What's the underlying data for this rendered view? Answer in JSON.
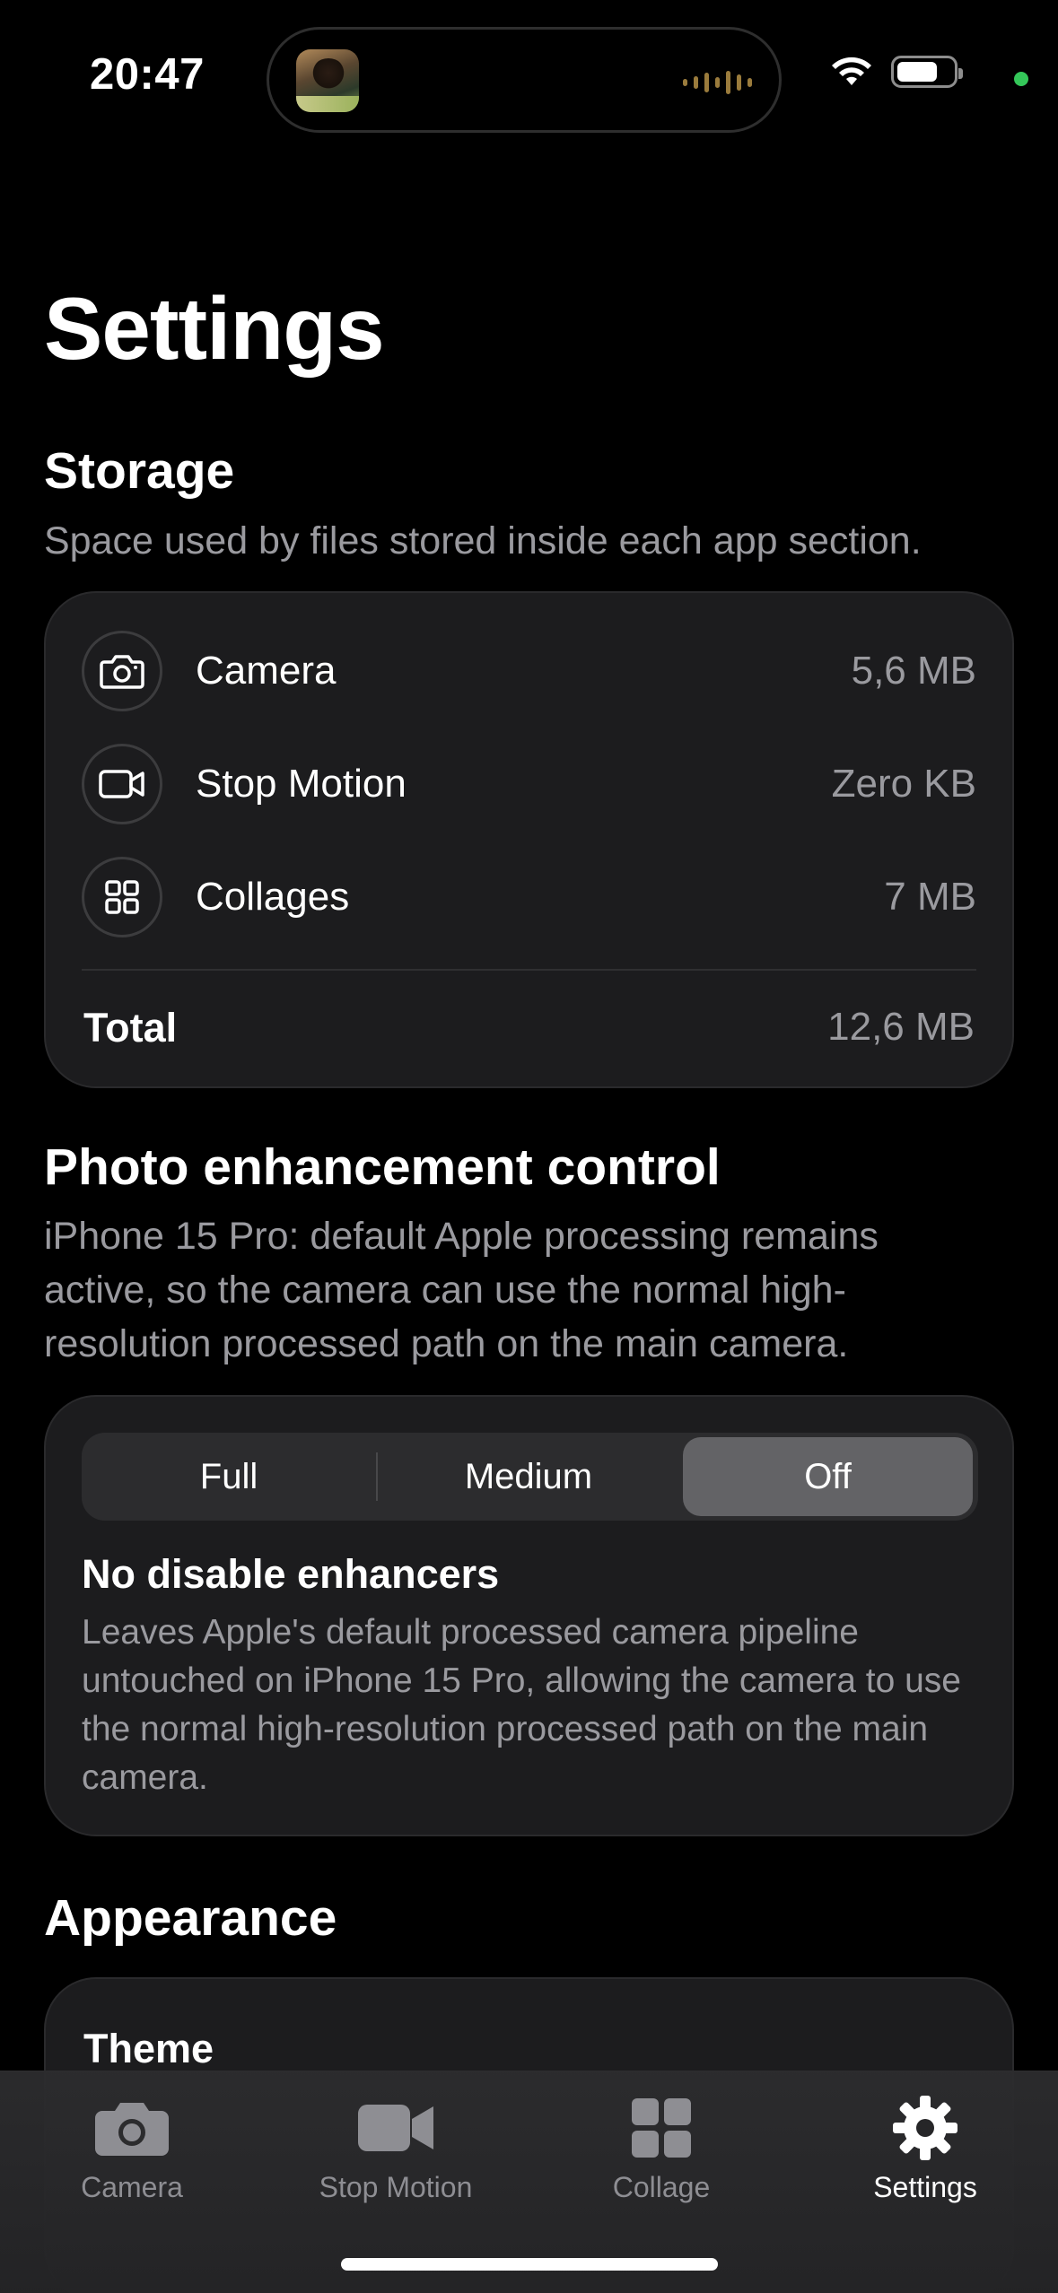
{
  "status_bar": {
    "time": "20:47",
    "icons": [
      "now-playing-artwork",
      "audio-waveform-icon",
      "wifi-icon",
      "battery-icon",
      "privacy-indicator-dot"
    ]
  },
  "page_title": "Settings",
  "storage": {
    "title": "Storage",
    "subtitle": "Space used by files stored inside each app section.",
    "items": [
      {
        "label": "Camera",
        "value": "5,6 MB",
        "icon": "camera-icon"
      },
      {
        "label": "Stop Motion",
        "value": "Zero KB",
        "icon": "video-icon"
      },
      {
        "label": "Collages",
        "value": "7 MB",
        "icon": "grid-icon"
      }
    ],
    "total_label": "Total",
    "total_value": "12,6 MB"
  },
  "enhancement": {
    "title": "Photo enhancement control",
    "subtitle": "iPhone 15 Pro: default Apple processing remains active, so the camera can use the normal high-resolution processed path on the main camera.",
    "options": [
      "Full",
      "Medium",
      "Off"
    ],
    "selected": "Off",
    "option_title": "No disable enhancers",
    "option_description": "Leaves Apple's default processed camera pipeline untouched on iPhone 15 Pro, allowing the camera to use the normal high-resolution processed path on the main camera."
  },
  "appearance": {
    "title": "Appearance",
    "theme_label": "Theme"
  },
  "tab_bar": {
    "tabs": [
      {
        "label": "Camera",
        "icon": "camera-fill-icon"
      },
      {
        "label": "Stop Motion",
        "icon": "video-fill-icon"
      },
      {
        "label": "Collage",
        "icon": "grid-fill-icon"
      },
      {
        "label": "Settings",
        "icon": "gear-icon"
      }
    ],
    "active": "Settings"
  },
  "colors": {
    "background": "#000000",
    "card": "#1c1c1e",
    "secondary_text": "#9a9a9f",
    "selected_segment": "#636366",
    "privacy_dot": "#34c759"
  }
}
